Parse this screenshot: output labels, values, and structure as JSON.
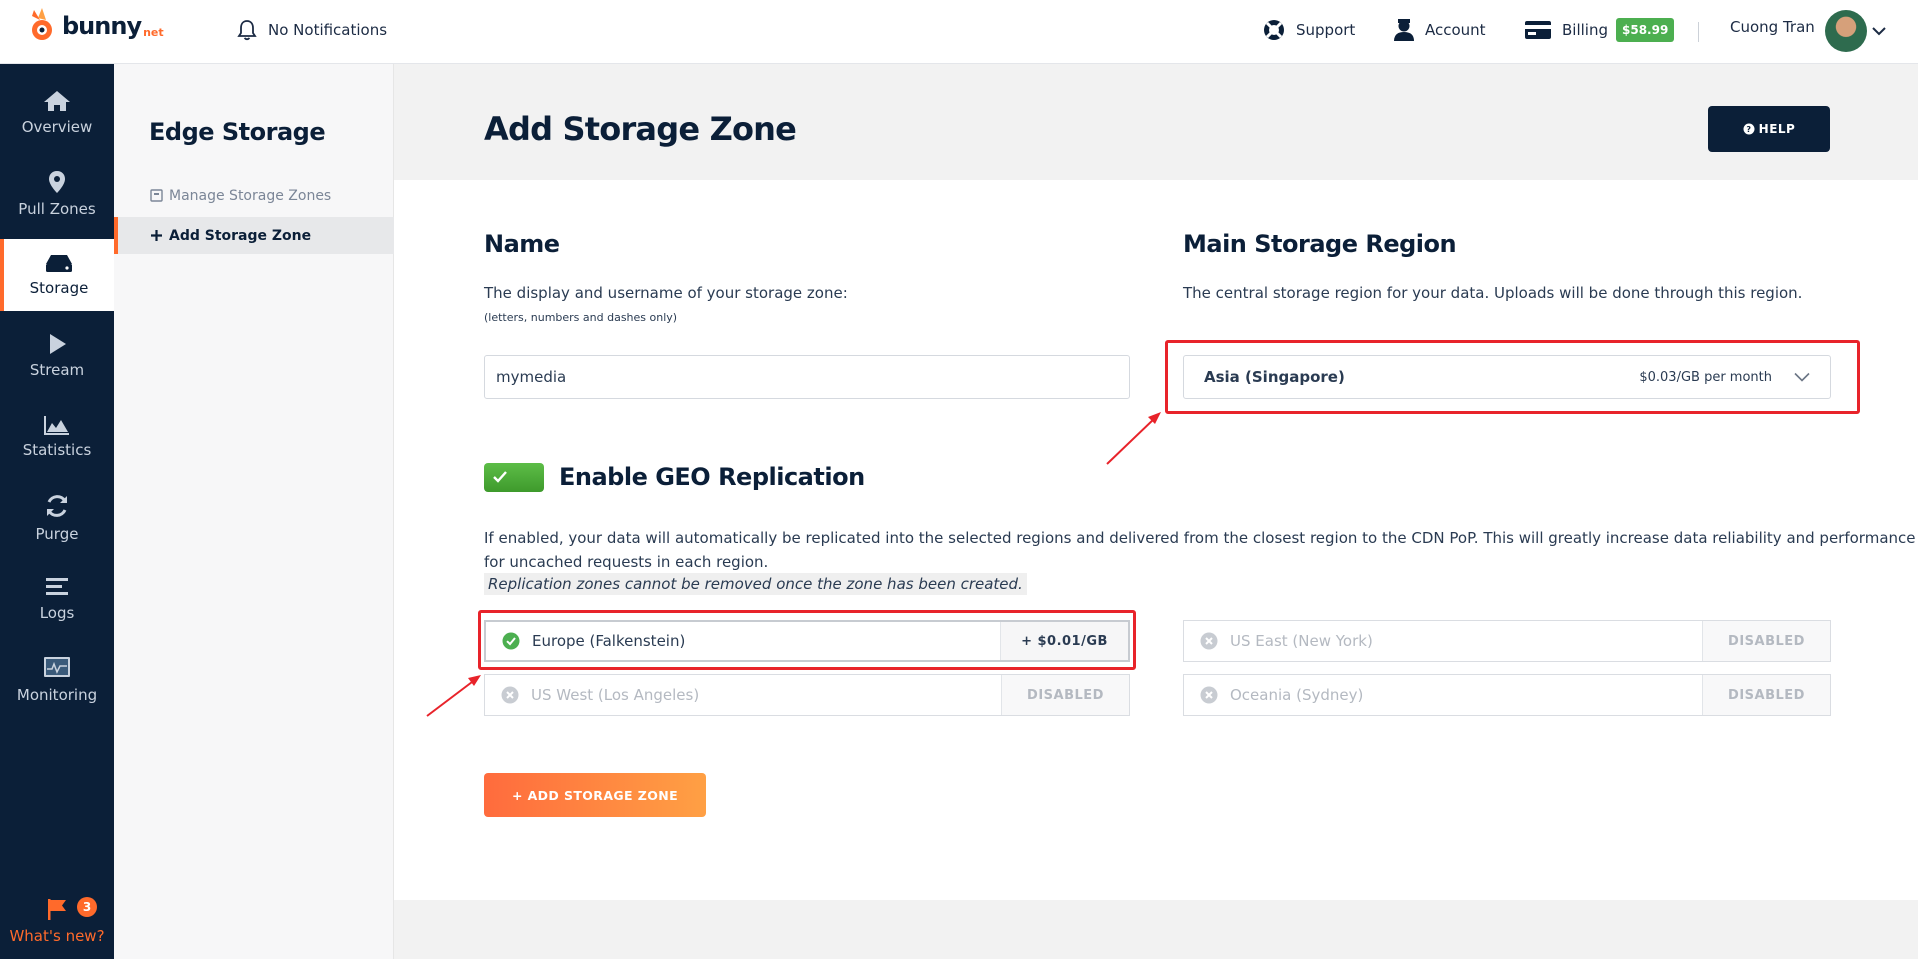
{
  "brand": {
    "name": "bunny",
    "tld": "net"
  },
  "topbar": {
    "notifications": "No Notifications",
    "support": "Support",
    "account": "Account",
    "billing": "Billing",
    "balance": "$58.99",
    "user_name": "Cuong Tran"
  },
  "sidebar": {
    "items": [
      {
        "label": "Overview",
        "icon": "home-icon"
      },
      {
        "label": "Pull Zones",
        "icon": "location-pin-icon"
      },
      {
        "label": "Storage",
        "icon": "storage-drive-icon"
      },
      {
        "label": "Stream",
        "icon": "play-icon"
      },
      {
        "label": "Statistics",
        "icon": "area-chart-icon"
      },
      {
        "label": "Purge",
        "icon": "refresh-icon"
      },
      {
        "label": "Logs",
        "icon": "list-lines-icon"
      },
      {
        "label": "Monitoring",
        "icon": "monitor-icon"
      }
    ],
    "active": "Storage",
    "whats_new": "What's new?",
    "whats_new_count": "3"
  },
  "subnav": {
    "title": "Edge Storage",
    "items": [
      {
        "label": "Manage Storage Zones"
      },
      {
        "label": "Add Storage Zone"
      }
    ]
  },
  "page": {
    "title": "Add Storage Zone",
    "help": "HELP"
  },
  "form": {
    "name_title": "Name",
    "name_desc": "The display and username of your storage zone:",
    "name_hint": "(letters, numbers and dashes only)",
    "name_value": "mymedia",
    "region_title": "Main Storage Region",
    "region_desc": "The central storage region for your data. Uploads will be done through this region.",
    "region_selected": "Asia (Singapore)",
    "region_price": "$0.03/GB per month",
    "geo_title": "Enable GEO Replication",
    "geo_enabled": true,
    "geo_desc_line1": "If enabled, your data will automatically be replicated into the selected regions and delivered from the closest region to the CDN PoP. This will greatly increase data reliability and performance",
    "geo_desc_line2": "for uncached requests in each region.",
    "geo_note": "Replication zones cannot be removed once the zone has been created.",
    "replication": [
      {
        "label": "Europe (Falkenstein)",
        "side": "+ $0.01/GB",
        "state": "selected"
      },
      {
        "label": "US East (New York)",
        "side": "DISABLED",
        "state": "disabled"
      },
      {
        "label": "US West (Los Angeles)",
        "side": "DISABLED",
        "state": "disabled"
      },
      {
        "label": "Oceania (Sydney)",
        "side": "DISABLED",
        "state": "disabled"
      }
    ],
    "submit": "+ ADD STORAGE ZONE"
  },
  "colors": {
    "accent": "#ff6a2b",
    "navy": "#0b1f38",
    "success": "#4caf50",
    "annotation": "#e8232a"
  }
}
